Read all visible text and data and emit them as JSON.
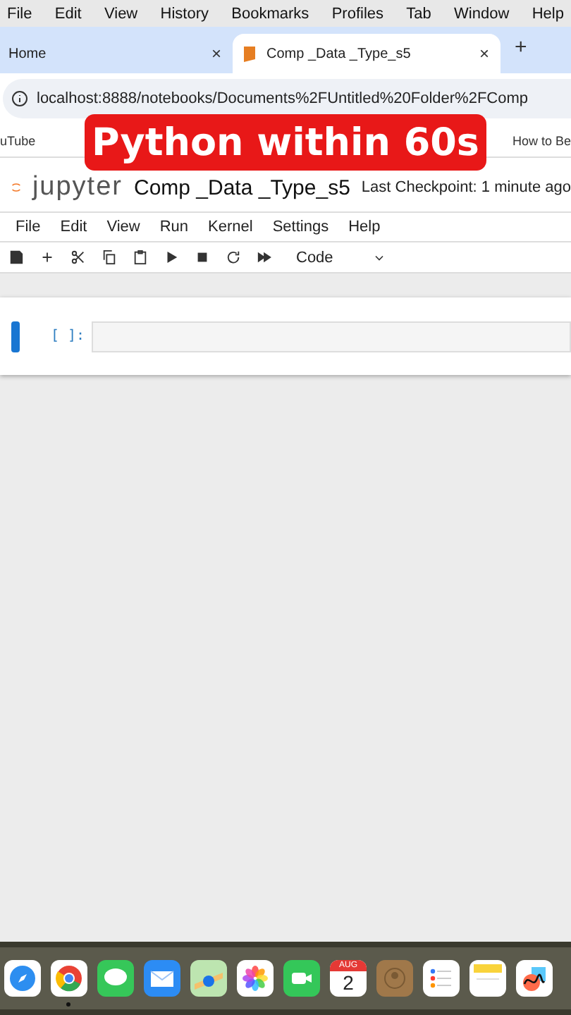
{
  "menu_bar": [
    "File",
    "Edit",
    "View",
    "History",
    "Bookmarks",
    "Profiles",
    "Tab",
    "Window",
    "Help"
  ],
  "tabs": [
    {
      "label": "Home",
      "selected": false,
      "close": "×"
    },
    {
      "label": "Comp _Data _Type_s5",
      "selected": true,
      "close": "×"
    }
  ],
  "new_tab": "+",
  "address": "localhost:8888/notebooks/Documents%2FUntitled%20Folder%2FComp",
  "bookmarks": [
    "uTube",
    "How to Be"
  ],
  "overlay_title": "Python within 60s",
  "notebook": {
    "logo": "jupyter",
    "title": "Comp _Data _Type_s5",
    "checkpoint": "Last Checkpoint: 1 minute ago",
    "menu": [
      "File",
      "Edit",
      "View",
      "Run",
      "Kernel",
      "Settings",
      "Help"
    ],
    "cell_type": "Code",
    "cells": [
      {
        "prompt": "[ ]:",
        "selected": true
      }
    ]
  },
  "dock": [
    {
      "kind": "safari",
      "running": false
    },
    {
      "kind": "chrome",
      "running": true
    },
    {
      "kind": "messages",
      "running": false
    },
    {
      "kind": "mail",
      "running": false
    },
    {
      "kind": "maps",
      "running": false
    },
    {
      "kind": "photos",
      "running": false
    },
    {
      "kind": "facetime",
      "running": false
    },
    {
      "kind": "calendar",
      "running": false,
      "month": "AUG",
      "day": "2"
    },
    {
      "kind": "contacts",
      "running": false
    },
    {
      "kind": "reminders",
      "running": false
    },
    {
      "kind": "notes",
      "running": false
    },
    {
      "kind": "freeform",
      "running": false
    }
  ]
}
